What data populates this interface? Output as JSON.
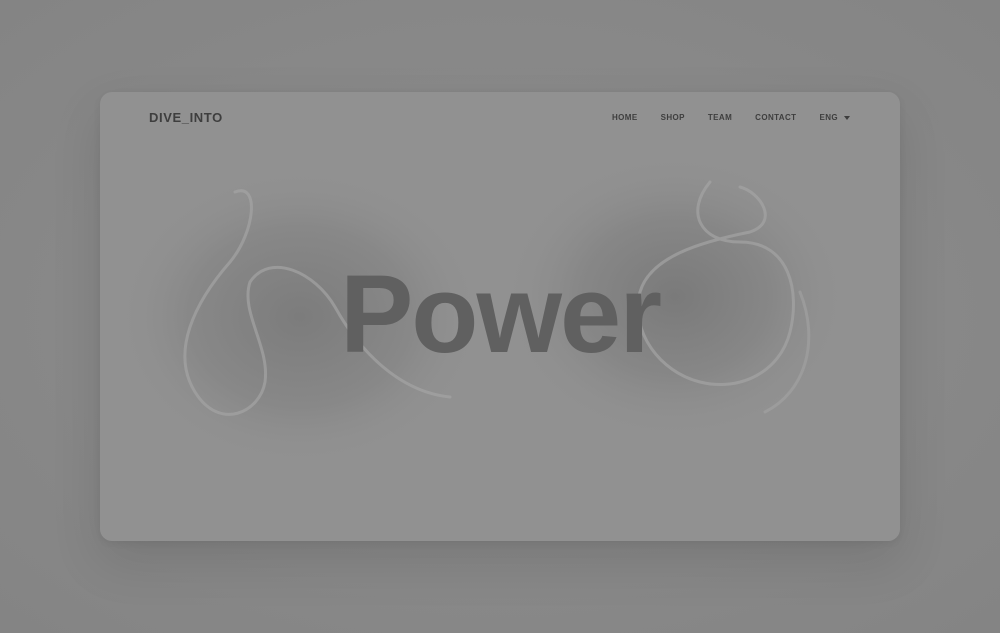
{
  "brand": {
    "logo_text": "DIVE_INTO"
  },
  "nav": {
    "items": [
      {
        "label": "HOME"
      },
      {
        "label": "SHOP"
      },
      {
        "label": "TEAM"
      },
      {
        "label": "CONTACT"
      }
    ],
    "language": {
      "label": "ENG",
      "icon": "caret-down-icon"
    }
  },
  "hero": {
    "title": "Power"
  },
  "colors": {
    "backdrop": "#8a8a8a",
    "card": "#919191",
    "text_dark": "#3e3e3e",
    "hero_text": "#606060"
  }
}
